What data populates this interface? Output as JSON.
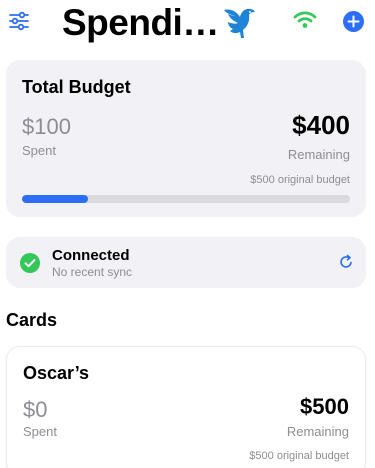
{
  "header": {
    "title": "Spendi…",
    "icons": {
      "filter": "sliders-icon",
      "bird": "bird-icon",
      "wifi": "wifi-icon",
      "add": "plus-icon"
    },
    "colors": {
      "accent": "#2c6ef5",
      "wifi": "#34c759"
    }
  },
  "budget": {
    "title": "Total Budget",
    "spent": "$100",
    "spent_label": "Spent",
    "remaining": "$400",
    "remaining_label": "Remaining",
    "original": "$500 original budget",
    "progress_fraction": 0.2
  },
  "sync": {
    "status": "Connected",
    "detail": "No recent sync",
    "icons": {
      "status": "checkmark-icon",
      "refresh": "refresh-icon"
    },
    "colors": {
      "status": "#34c759"
    }
  },
  "cards_section": {
    "title": "Cards",
    "items": [
      {
        "name": "Oscar’s",
        "spent": "$0",
        "spent_label": "Spent",
        "remaining": "$500",
        "remaining_label": "Remaining",
        "original": "$500 original budget"
      }
    ]
  }
}
